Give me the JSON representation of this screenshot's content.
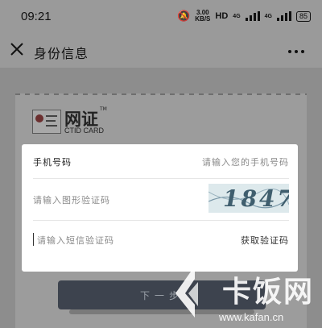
{
  "status_bar": {
    "time": "09:21",
    "speed_value": "3.00",
    "speed_unit": "KB/S",
    "hd": "HD",
    "network_1": "4G",
    "network_2": "4G",
    "battery": "85"
  },
  "header": {
    "title": "身份信息"
  },
  "logo": {
    "title": "网证",
    "tm": "TM",
    "subtitle": "CTID CARD"
  },
  "form": {
    "phone_label": "手机号码",
    "phone_placeholder": "请输入您的手机号码",
    "captcha_placeholder": "请输入图形验证码",
    "captcha_image_text": "1847",
    "sms_placeholder": "请输入短信验证码",
    "get_code_label": "获取验证码"
  },
  "next_button": {
    "label": "下一步"
  },
  "watermark": {
    "name": "卡饭网",
    "url": "www.kafan.cn"
  },
  "colors": {
    "overlay_gray": "#8d8d8d",
    "panel_white": "#ffffff",
    "button_dark": "#3d434e",
    "captcha_bg": "#dde9ec"
  }
}
